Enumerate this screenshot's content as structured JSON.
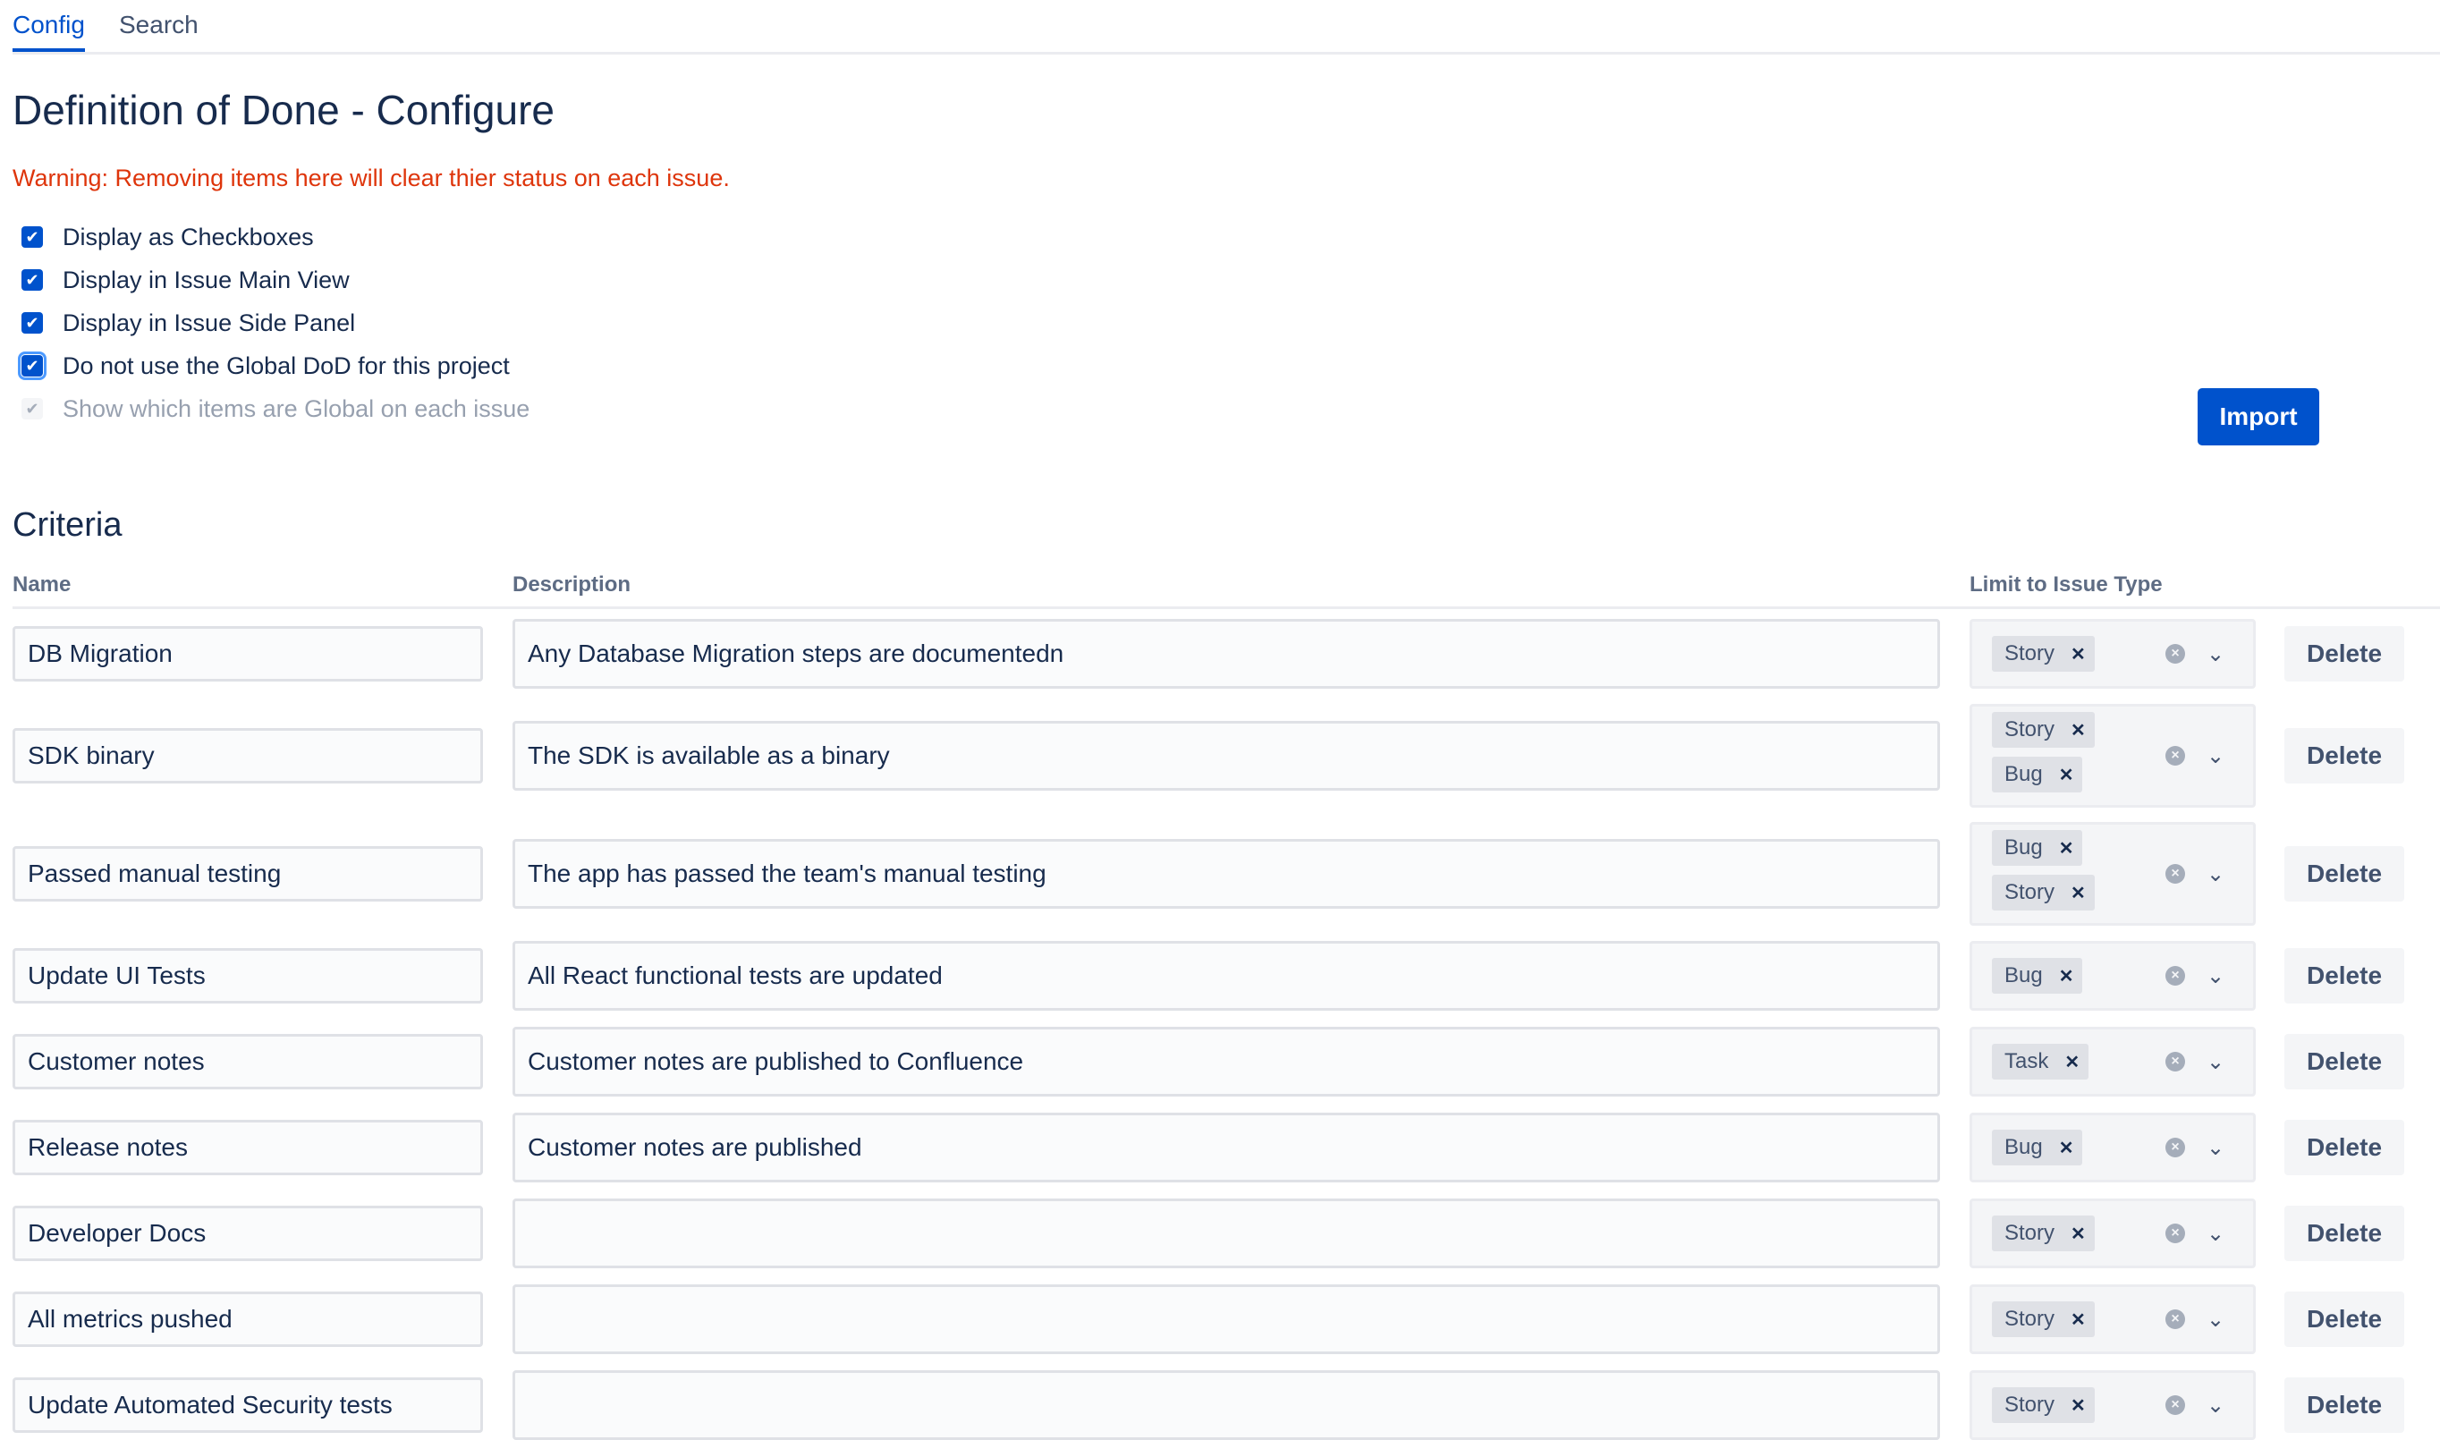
{
  "tabs": [
    {
      "label": "Config",
      "active": true
    },
    {
      "label": "Search",
      "active": false
    }
  ],
  "page": {
    "title": "Definition of Done - Configure",
    "warning": "Warning: Removing items here will clear thier status on each issue."
  },
  "options": [
    {
      "label": "Display as Checkboxes",
      "checked": true
    },
    {
      "label": "Display in Issue Main View",
      "checked": true
    },
    {
      "label": "Display in Issue Side Panel",
      "checked": true
    },
    {
      "label": "Do not use the Global DoD for this project",
      "checked": true
    },
    {
      "label": "Show which items are Global on each issue",
      "checked": true,
      "disabled": true
    }
  ],
  "import_label": "Import",
  "criteria": {
    "heading": "Criteria",
    "columns": {
      "name": "Name",
      "description": "Description",
      "issue_type": "Limit to Issue Type"
    },
    "delete_label": "Delete",
    "rows": [
      {
        "name": "DB Migration",
        "description": "Any Database Migration steps are documentedn",
        "types": [
          "Story"
        ]
      },
      {
        "name": "SDK binary",
        "description": "The SDK is available as a binary",
        "types": [
          "Story",
          "Bug"
        ]
      },
      {
        "name": "Passed manual testing",
        "description": "The app has passed the team's manual testing",
        "types": [
          "Bug",
          "Story"
        ]
      },
      {
        "name": "Update UI Tests",
        "description": "All React functional tests are updated",
        "types": [
          "Bug"
        ]
      },
      {
        "name": "Customer notes",
        "description": "Customer notes are published to Confluence",
        "types": [
          "Task"
        ]
      },
      {
        "name": "Release notes",
        "description": "Customer notes are published",
        "types": [
          "Bug"
        ]
      },
      {
        "name": "Developer Docs",
        "description": "",
        "types": [
          "Story"
        ]
      },
      {
        "name": "All metrics pushed",
        "description": "",
        "types": [
          "Story"
        ]
      },
      {
        "name": "Update Automated Security tests",
        "description": "",
        "types": [
          "Story"
        ]
      }
    ]
  },
  "colors": {
    "primary": "#0052cc",
    "warning": "#de350b",
    "text": "#172b4d"
  },
  "icons": {
    "checkbox": "check-icon",
    "tag_remove": "x-icon",
    "clear": "clear-circle-icon",
    "dropdown": "chevron-down-icon"
  }
}
